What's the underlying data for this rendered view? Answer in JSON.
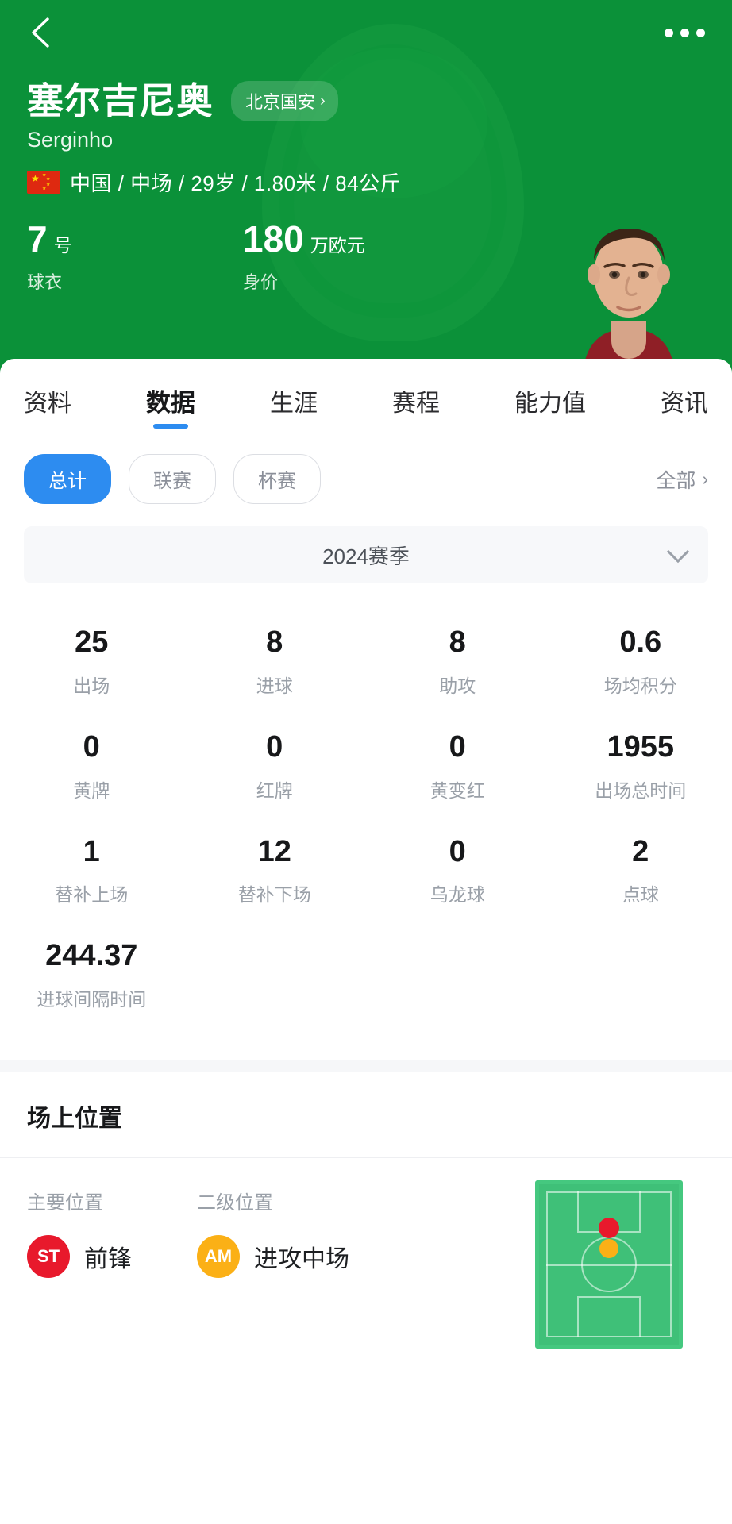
{
  "topbar": {
    "back_icon": "chevron-left-icon",
    "more_icon": "more-horizontal-icon"
  },
  "hero": {
    "player_name": "塞尔吉尼奥",
    "team": "北京国安",
    "team_chevron": "›",
    "latin_name": "Serginho",
    "meta": "中国 / 中场 / 29岁 / 1.80米 / 84公斤",
    "nationality_flag": "china-flag-icon",
    "kpis": [
      {
        "num": "7",
        "unit": "号",
        "label": "球衣"
      },
      {
        "num": "180",
        "unit": "万欧元",
        "label": "身价"
      }
    ],
    "photo_alt": "player-photo"
  },
  "tabs": [
    {
      "label": "资料",
      "active": false
    },
    {
      "label": "数据",
      "active": true
    },
    {
      "label": "生涯",
      "active": false
    },
    {
      "label": "赛程",
      "active": false
    },
    {
      "label": "能力值",
      "active": false
    },
    {
      "label": "资讯",
      "active": false
    }
  ],
  "filters": {
    "pills": [
      {
        "label": "总计",
        "active": true
      },
      {
        "label": "联赛",
        "active": false
      },
      {
        "label": "杯赛",
        "active": false
      }
    ],
    "all_label": "全部",
    "all_chevron": "›"
  },
  "season": {
    "label": "2024赛季",
    "caret_icon": "chevron-down-icon"
  },
  "stats": [
    {
      "value": "25",
      "label": "出场"
    },
    {
      "value": "8",
      "label": "进球"
    },
    {
      "value": "8",
      "label": "助攻"
    },
    {
      "value": "0.6",
      "label": "场均积分"
    },
    {
      "value": "0",
      "label": "黄牌"
    },
    {
      "value": "0",
      "label": "红牌"
    },
    {
      "value": "0",
      "label": "黄变红"
    },
    {
      "value": "1955",
      "label": "出场总时间"
    },
    {
      "value": "1",
      "label": "替补上场"
    },
    {
      "value": "12",
      "label": "替补下场"
    },
    {
      "value": "0",
      "label": "乌龙球"
    },
    {
      "value": "2",
      "label": "点球"
    },
    {
      "value": "244.37",
      "label": "进球间隔时间"
    },
    {
      "value": "",
      "label": ""
    },
    {
      "value": "",
      "label": ""
    },
    {
      "value": "",
      "label": ""
    }
  ],
  "positions": {
    "section_title": "场上位置",
    "primary": {
      "head": "主要位置",
      "code": "ST",
      "name": "前锋",
      "color": "#e8192c"
    },
    "secondary": {
      "head": "二级位置",
      "code": "AM",
      "name": "进攻中场",
      "color": "#fbb016"
    },
    "pitch": {
      "name": "pitch-diagram",
      "field_color": "#3fc078"
    }
  }
}
